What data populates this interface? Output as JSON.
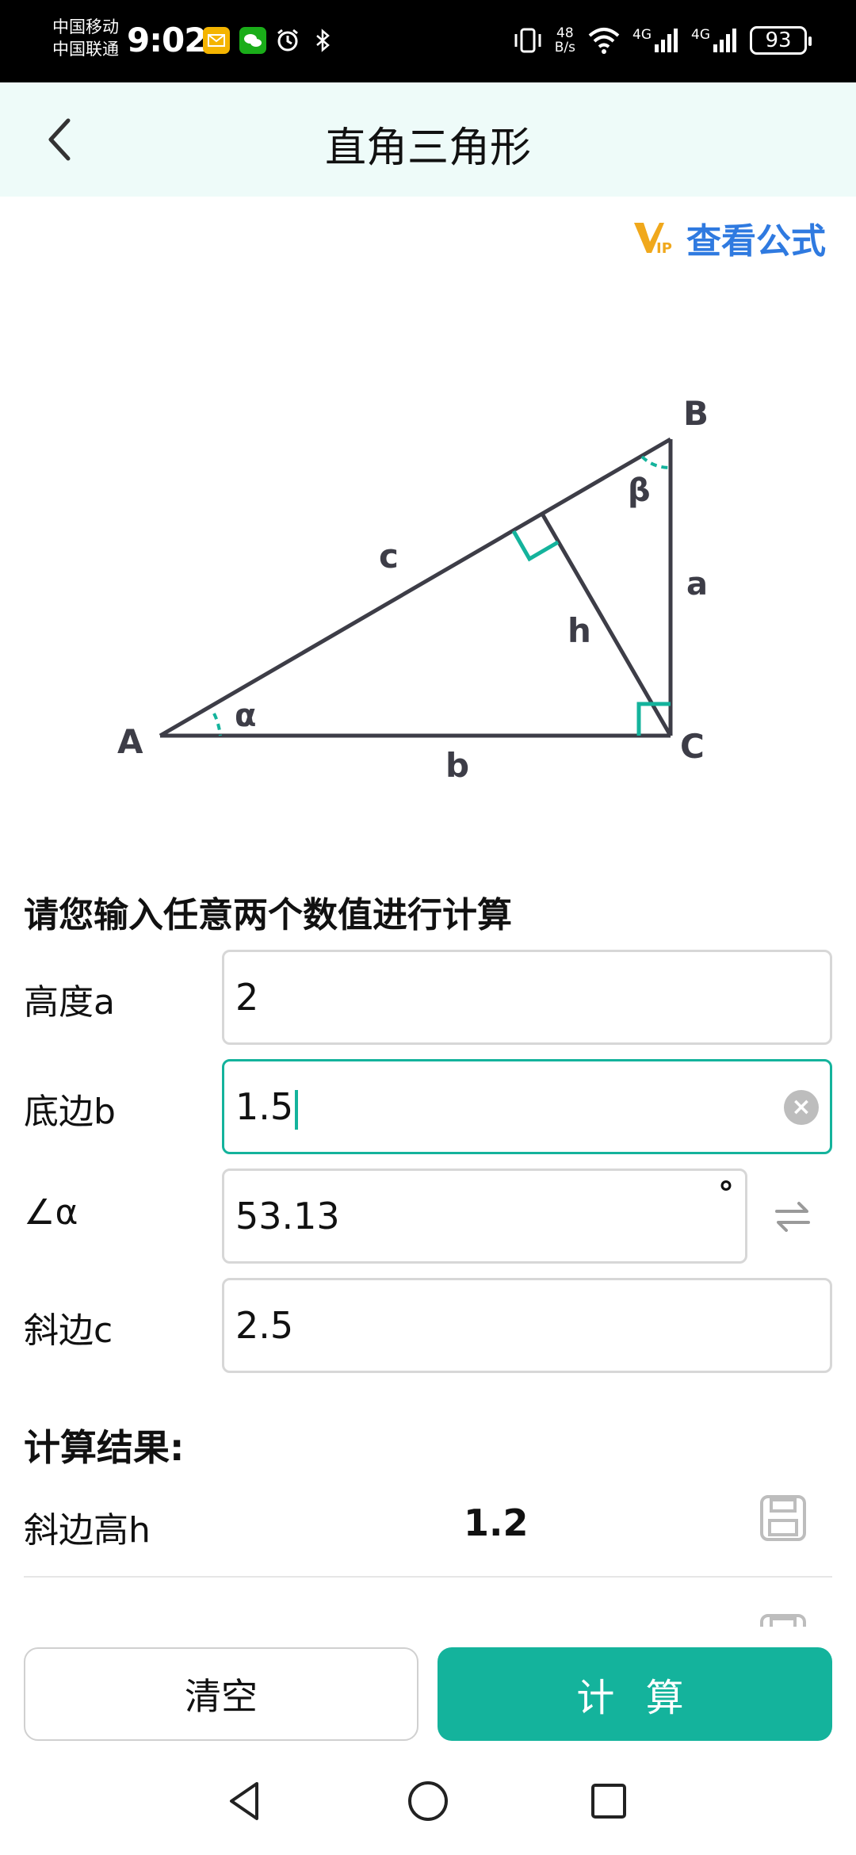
{
  "status_bar": {
    "carrier1": "中国移动",
    "carrier2": "中国联通",
    "time": "9:02",
    "net_speed_top": "48",
    "net_speed_bottom": "B/s",
    "signal1": "4G",
    "signal2": "4G",
    "battery": "93"
  },
  "header": {
    "title": "直角三角形"
  },
  "formula_link": {
    "vip_text": "VIP",
    "label": "查看公式"
  },
  "diagram": {
    "vertex_a": "A",
    "vertex_b": "B",
    "vertex_c": "C",
    "side_a": "a",
    "side_b": "b",
    "side_c": "c",
    "height": "h",
    "angle_alpha": "α",
    "angle_beta": "β"
  },
  "form": {
    "prompt": "请您输入任意两个数值进行计算",
    "fields": [
      {
        "label": "高度a",
        "value": "2"
      },
      {
        "label": "底边b",
        "value": "1.5"
      },
      {
        "label": "∠α",
        "value": "53.13",
        "unit": "°"
      },
      {
        "label": "斜边c",
        "value": "2.5"
      }
    ]
  },
  "results": {
    "title": "计算结果:",
    "items": [
      {
        "label": "斜边高h",
        "value": "1.2"
      }
    ]
  },
  "actions": {
    "clear": "清空",
    "calculate": "计 算"
  },
  "colors": {
    "accent": "#14b39c",
    "header_bg": "#eefbf9",
    "link": "#2f7ae0",
    "vip": "#f0a81c"
  }
}
